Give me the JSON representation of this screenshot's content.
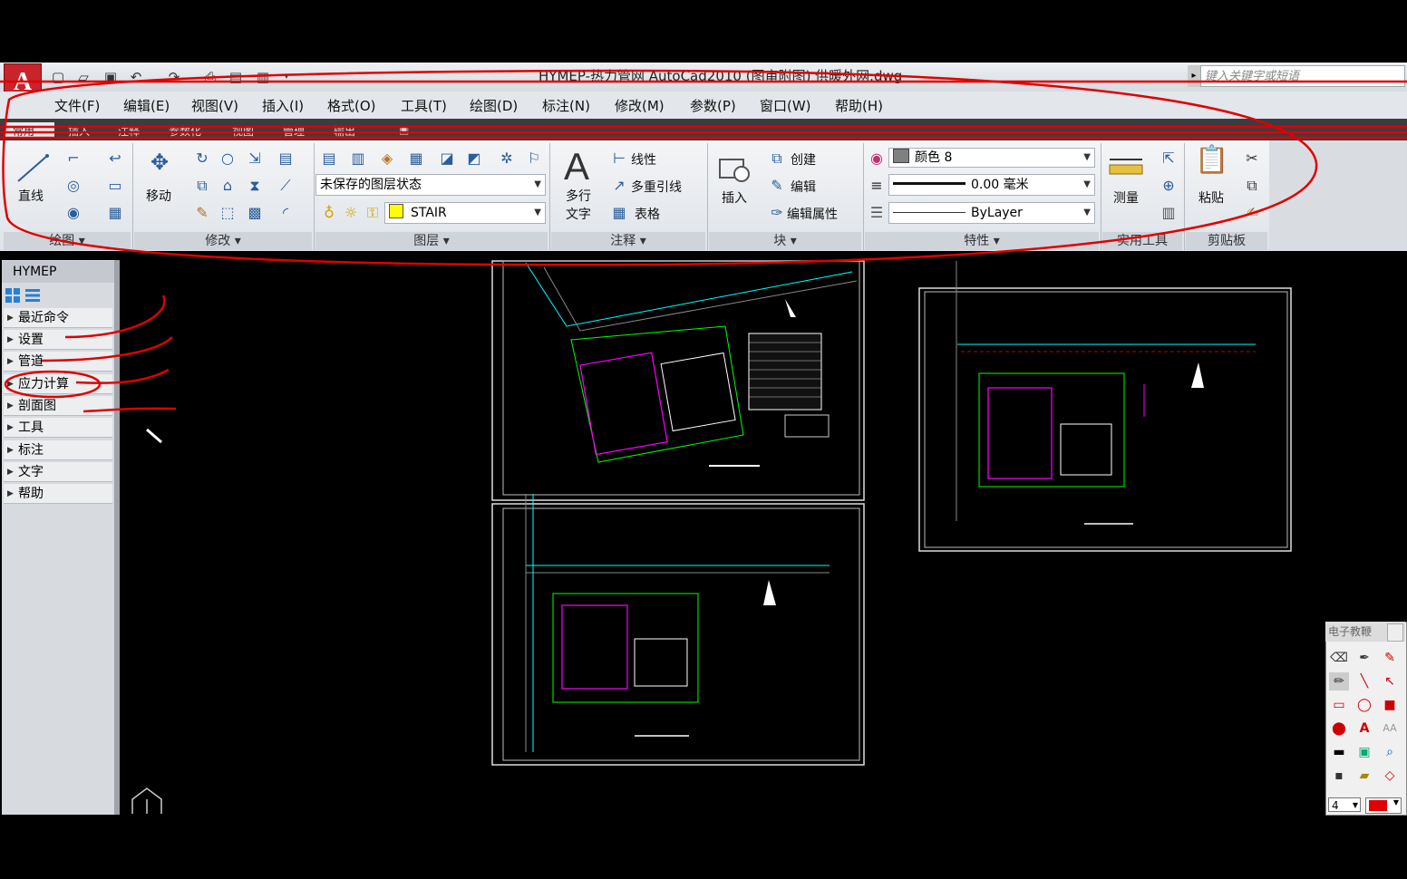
{
  "window": {
    "title": "HYMEP-热力管网 AutoCad2010        (图审附图) 供暖外网.dwg",
    "search_placeholder": "键入关键字或短语"
  },
  "quick_access": [
    "new-icon",
    "open-icon",
    "save-icon",
    "undo-icon",
    "redo-icon",
    "print-icon",
    "publish-icon",
    "plot-icon",
    "dropdown-icon"
  ],
  "menu": [
    "文件(F)",
    "编辑(E)",
    "视图(V)",
    "插入(I)",
    "格式(O)",
    "工具(T)",
    "绘图(D)",
    "标注(N)",
    "修改(M)",
    "参数(P)",
    "窗口(W)",
    "帮助(H)"
  ],
  "ribbon_tabs": [
    "常用",
    "插入",
    "注释",
    "参数化",
    "视图",
    "管理",
    "输出",
    "▣"
  ],
  "ribbon": {
    "draw": {
      "title": "绘图",
      "line_label": "直线"
    },
    "modify": {
      "title": "修改",
      "move_label": "移动"
    },
    "layers": {
      "title": "图层",
      "layer_state": "未保存的图层状态",
      "current_layer": "STAIR",
      "layer_color": "#ffff00"
    },
    "annotation": {
      "title": "注释",
      "mtext_label": "多行\n文字",
      "mtext_line1": "多行",
      "mtext_line2": "文字",
      "linear": "线性",
      "multileader": "多重引线",
      "table": "表格"
    },
    "block": {
      "title": "块",
      "insert": "插入",
      "create": "创建",
      "edit": "编辑",
      "edit_attr": "编辑属性"
    },
    "properties": {
      "title": "特性",
      "color": "颜色 8",
      "lineweight": "0.00 毫米",
      "linetype": "ByLayer"
    },
    "utilities": {
      "title": "实用工具",
      "measure": "测量"
    },
    "clipboard": {
      "title": "剪贴板",
      "paste": "粘贴"
    }
  },
  "sidebar": {
    "title": "HYMEP",
    "items": [
      "最近命令",
      "设置",
      "管道",
      "应力计算",
      "剖面图",
      "工具",
      "标注",
      "文字",
      "帮助"
    ]
  },
  "palette": {
    "title": "电子教鞭",
    "size_value": "4",
    "pen_color": "#e00000"
  },
  "colors": {
    "annotation_red": "#e00000",
    "cad_bg": "#000000"
  }
}
